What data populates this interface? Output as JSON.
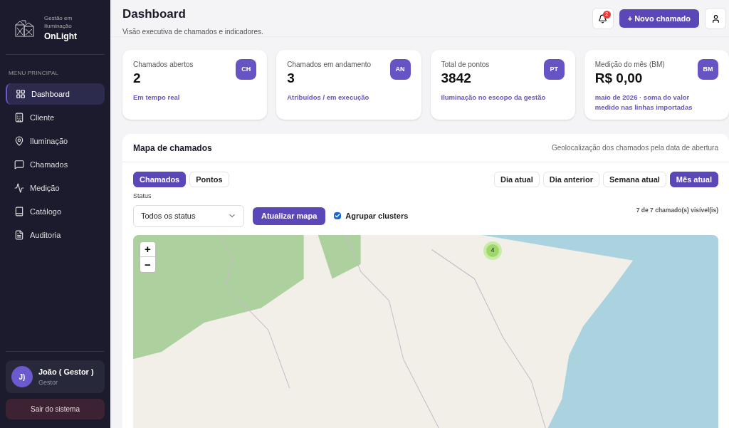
{
  "sidebar": {
    "brand": {
      "subtitle": "Gestão em Iluminação",
      "name": "OnLight"
    },
    "section_label": "MENU PRINCIPAL",
    "items": [
      {
        "label": "Dashboard",
        "selected": true
      },
      {
        "label": "Cliente",
        "selected": false
      },
      {
        "label": "Iluminação",
        "selected": false
      },
      {
        "label": "Chamados",
        "selected": false
      },
      {
        "label": "Medição",
        "selected": false
      },
      {
        "label": "Catálogo",
        "selected": false
      },
      {
        "label": "Auditoria",
        "selected": false
      }
    ],
    "user": {
      "initials": "J)",
      "name": "João ( Gestor )",
      "role": "Gestor"
    },
    "logout": "Sair do sistema"
  },
  "header": {
    "title": "Dashboard",
    "subtitle": "Visão executiva de chamados e indicadores.",
    "notification_count": "2",
    "new_button": "+ Novo chamado"
  },
  "stats": [
    {
      "label": "Chamados abertos",
      "value": "2",
      "badge": "CH",
      "note": "Em tempo real"
    },
    {
      "label": "Chamados em andamento",
      "value": "3",
      "badge": "AN",
      "note": "Atribuídos / em execução"
    },
    {
      "label": "Total de pontos",
      "value": "3842",
      "badge": "PT",
      "note": "Iluminação no escopo da gestão"
    },
    {
      "label": "Medição do mês (BM)",
      "value": "R$ 0,00",
      "badge": "BM",
      "note": "maio de 2026 · soma do valor medido nas linhas importadas"
    }
  ],
  "map_panel": {
    "title": "Mapa de chamados",
    "description": "Geolocalização dos chamados pela data de abertura",
    "layer_tabs": [
      {
        "label": "Chamados",
        "selected": true
      },
      {
        "label": "Pontos",
        "selected": false
      }
    ],
    "period_tabs": [
      {
        "label": "Dia atual",
        "selected": false
      },
      {
        "label": "Dia anterior",
        "selected": false
      },
      {
        "label": "Semana atual",
        "selected": false
      },
      {
        "label": "Mês atual",
        "selected": true
      }
    ],
    "status_label": "Status",
    "status_select": {
      "value": "Todos os status"
    },
    "refresh_button": "Atualizar mapa",
    "cluster_checkbox": {
      "label": "Agrupar clusters",
      "checked": true
    },
    "visible_count": "7 de 7 chamado(s) visível(is)",
    "zoom_in": "+",
    "zoom_out": "−",
    "cluster_marker": {
      "count": "4"
    }
  }
}
